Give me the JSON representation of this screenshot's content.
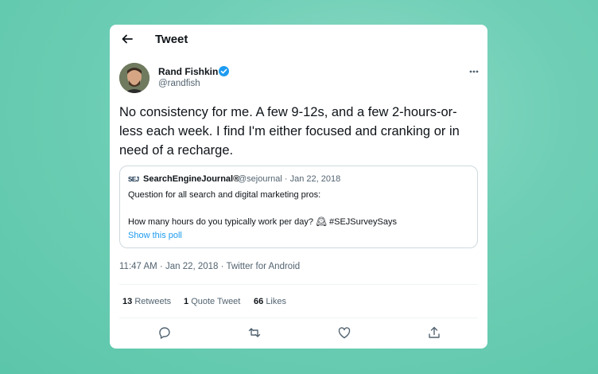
{
  "header": {
    "title": "Tweet"
  },
  "author": {
    "name": "Rand Fishkin",
    "handle": "@randfish"
  },
  "tweet": {
    "text": "No consistency for me. A few 9-12s, and a few 2-hours-or-less each week. I find I'm either focused and cranking or in need of a recharge."
  },
  "quote": {
    "logo": "SEJ",
    "name": "SearchEngineJournal®",
    "meta": "@sejournal · Jan 22, 2018",
    "line1": "Question for all search and digital marketing pros:",
    "line2": "How many hours do you typically work per day? 🕰 #SEJSurveySays",
    "link": "Show this poll"
  },
  "timestamp": "11:47 AM · Jan 22, 2018 · Twitter for Android",
  "stats": {
    "retweets": {
      "count": "13",
      "label": "Retweets"
    },
    "quotes": {
      "count": "1",
      "label": "Quote Tweet"
    },
    "likes": {
      "count": "66",
      "label": "Likes"
    }
  },
  "icons": [
    "back-arrow-icon",
    "verified-badge-icon",
    "more-icon",
    "reply-icon",
    "retweet-icon",
    "like-icon",
    "share-icon"
  ],
  "colors": {
    "background": "#6fcfb6",
    "link": "#1d9bf0",
    "verified": "#1d9bf0"
  }
}
